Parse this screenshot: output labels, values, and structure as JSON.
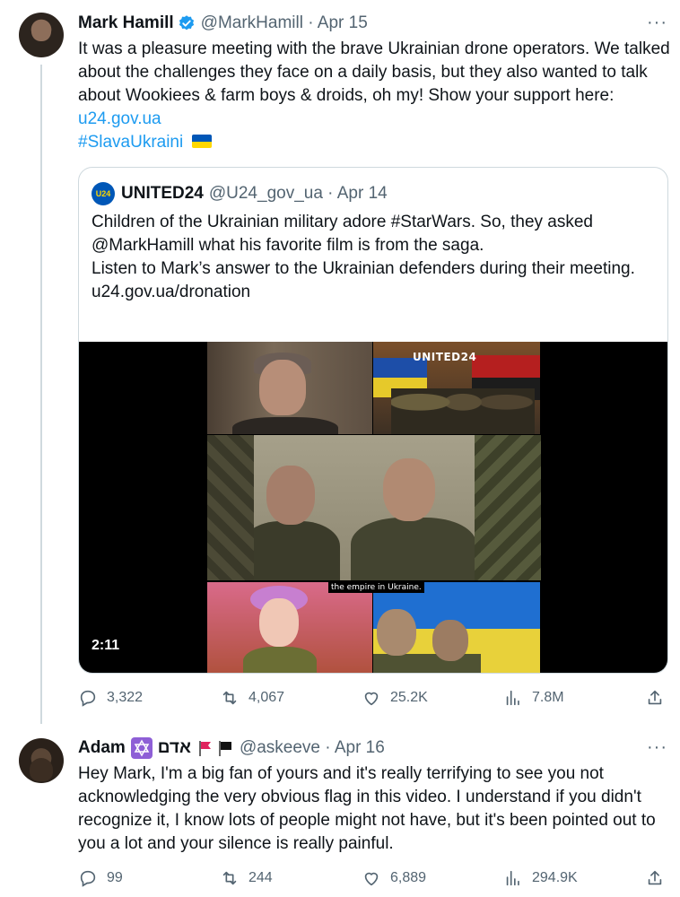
{
  "main_tweet": {
    "author_name": "Mark Hamill",
    "handle_date": "@MarkHamill · Apr 15",
    "text": "It was a pleasure meeting with the brave Ukrainian drone operators. We talked about the challenges they face on a daily basis, but they also wanted to talk about Wookiees & farm boys & droids, oh my! Show your support here: ",
    "link": "u24.gov.ua",
    "hashtag": "#SlavaUkraini",
    "more_label": "···",
    "quote": {
      "logo_text": "U24",
      "author_name": "UNITED24",
      "handle_date": "@U24_gov_ua · Apr 14",
      "line1": "Children of the Ukrainian military adore #StarWars. So, they asked @MarkHamill what his favorite film is from the saga.",
      "line2": "Listen to Mark’s answer to the Ukrainian defenders during their meeting.",
      "line3": "u24.gov.ua/dronation",
      "video_logo": "UNITED24",
      "video_subtitle": "the empire in Ukraine.",
      "video_duration": "2:11"
    },
    "actions": {
      "replies": "3,322",
      "retweets": "4,067",
      "likes": "25.2K",
      "views": "7.8M"
    }
  },
  "reply_tweet": {
    "author_name": "Adam",
    "name_hebrew": "אדם",
    "handle_date": "@askeeve · Apr 16",
    "more_label": "···",
    "text": "Hey Mark, I'm a big fan of yours and it's really terrifying to see you not acknowledging the very obvious flag in this video. I understand if you didn't recognize it, I know lots of people might not have, but it's been pointed out to you a lot and your silence is really painful.",
    "actions": {
      "replies": "99",
      "retweets": "244",
      "likes": "6,889",
      "views": "294.9K"
    }
  },
  "colors": {
    "link": "#1d9bf0",
    "secondary_text": "#536471",
    "border": "#cfd9de",
    "verified": "#1d9bf0"
  },
  "icons": [
    "verified-badge-icon",
    "reply-icon",
    "retweet-icon",
    "like-icon",
    "views-icon",
    "share-icon",
    "more-icon",
    "star-of-david-icon",
    "red-flag-icon",
    "black-flag-icon",
    "ukraine-flag-icon"
  ]
}
